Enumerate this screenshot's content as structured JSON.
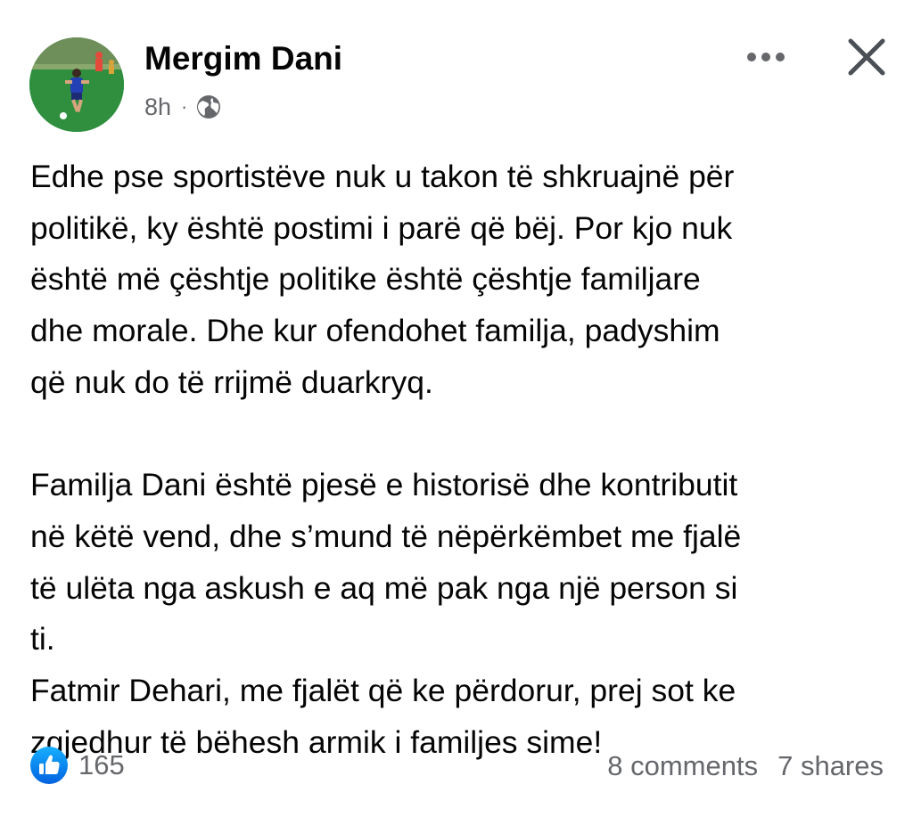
{
  "post": {
    "author": "Mergim Dani",
    "time": "8h",
    "separator": "·",
    "audience_icon": "globe-icon",
    "avatar_icon": "avatar-football-player",
    "paragraphs": [
      "Edhe pse sportistëve nuk u takon të shkruajnë për",
      "politikë, ky është postimi i parë që bëj. Por kjo nuk",
      "është më çështje politike është çështje familjare",
      "dhe morale. Dhe kur ofendohet familja, padyshim",
      "që nuk do të rrijmë duarkryq.",
      "",
      "Familja Dani është pjesë e historisë dhe kontributit",
      "në këtë vend, dhe s’mund të nëpërkëmbet me fjalë",
      "të ulëta nga askush e aq më pak nga një person si",
      "ti.",
      "Fatmir Dehari, me fjalët që ke përdorur, prej sot ke",
      "zgjedhur të bëhesh armik i familjes sime!"
    ]
  },
  "header": {
    "more_icon": "more-options-icon",
    "close_icon": "close-icon"
  },
  "footer": {
    "like_icon": "like-icon",
    "reaction_count": "165",
    "comments": "8 comments",
    "shares": "7 shares"
  },
  "colors": {
    "text_primary": "#050505",
    "text_secondary": "#65676b",
    "like_blue": "#1877f2",
    "background": "#ffffff"
  }
}
